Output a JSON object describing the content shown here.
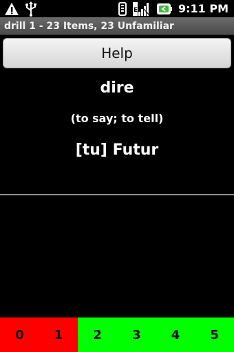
{
  "status_bar": {
    "time": "9:11 PM",
    "icons": [
      "warning-icon",
      "usb-icon",
      "vibrate-icon",
      "signal-icon",
      "battery-icon"
    ]
  },
  "title_bar": {
    "title": "drill 1 - 23 Items, 23 Unfamiliar"
  },
  "help_button": {
    "label": "Help"
  },
  "card": {
    "word": "dire",
    "meaning": "(to say; to tell)",
    "prompt": "[tu] Futur"
  },
  "rating": {
    "buttons": [
      {
        "label": "0",
        "color": "#ff0000"
      },
      {
        "label": "1",
        "color": "#ff0000"
      },
      {
        "label": "2",
        "color": "#00ff00"
      },
      {
        "label": "3",
        "color": "#00ff00"
      },
      {
        "label": "4",
        "color": "#00ff00"
      },
      {
        "label": "5",
        "color": "#00ff00"
      }
    ]
  },
  "colors": {
    "background": "#000000",
    "divider": "#8f8f8f",
    "fail": "#ff0000",
    "pass": "#00ff00"
  }
}
